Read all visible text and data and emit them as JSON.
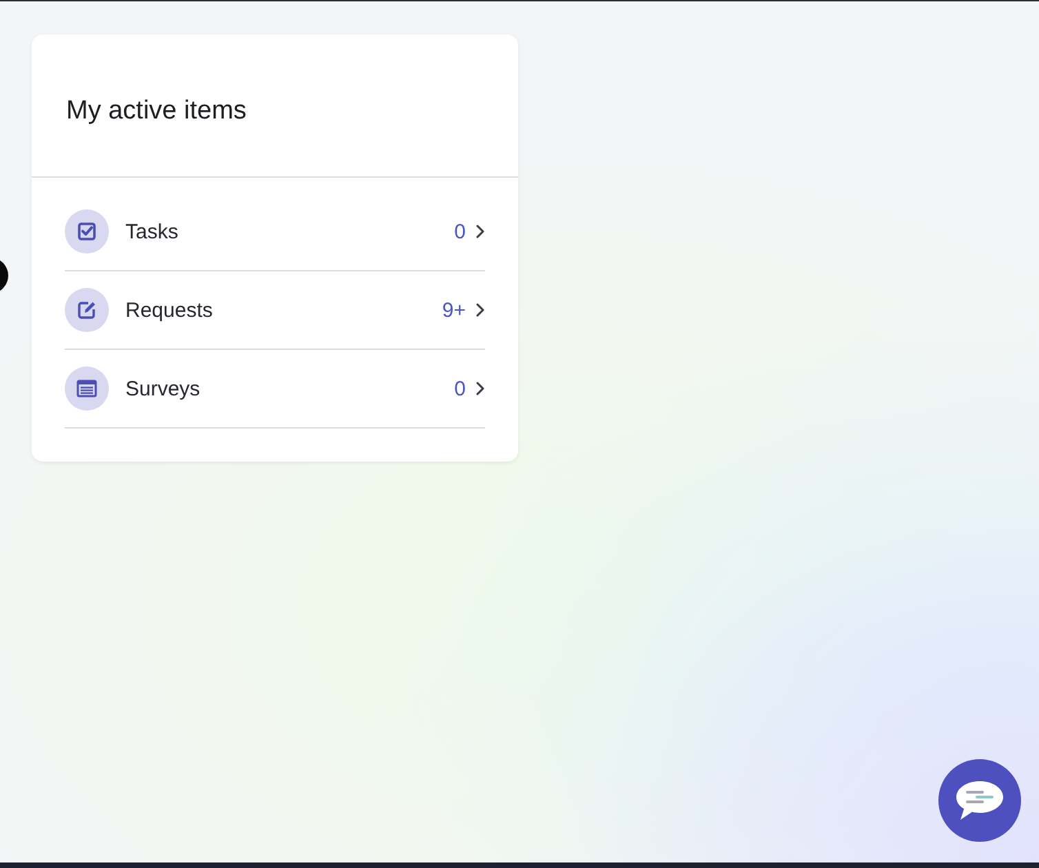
{
  "card": {
    "title": "My active items",
    "items": [
      {
        "kind": "task",
        "label": "Tasks",
        "count": "0"
      },
      {
        "kind": "request",
        "label": "Requests",
        "count": "9+"
      },
      {
        "kind": "survey",
        "label": "Surveys",
        "count": "0"
      }
    ]
  }
}
